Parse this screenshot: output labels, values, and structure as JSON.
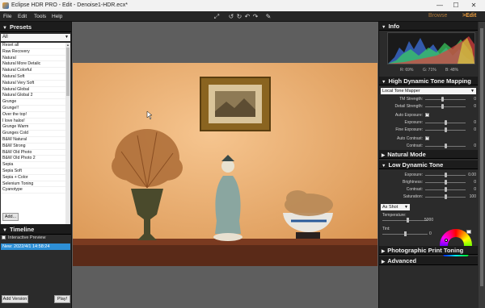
{
  "window": {
    "title": "Eclipse HDR PRO - Edit - Denoise1-HDR.ecx*",
    "minimize": "—",
    "maximize": "☐",
    "close": "✕"
  },
  "menu": {
    "items": [
      "File",
      "Edit",
      "Tools",
      "Help"
    ],
    "browse": "Browse",
    "edit": ">Edit",
    "tools": [
      "fit-screen-icon",
      "rotate-left-icon",
      "rotate-right-icon",
      "undo-icon",
      "redo-icon",
      "brush-icon"
    ],
    "tool_glyphs": [
      "⤢",
      "↺",
      "↻",
      "↶",
      "↷",
      "✎"
    ]
  },
  "presets": {
    "header": "Presets",
    "filter": "All",
    "items": [
      "Reset all",
      "Raw Recovery",
      "Natural",
      "Natural More Detalic",
      "Natural Colorful",
      "Natural Soft",
      "Natural Very Soft",
      "Natural Global",
      "Natural Global 2",
      "Grunge",
      "Grunge!!",
      "Over the top!",
      "I love halos!",
      "Grunge Warm",
      "Grunges Cold",
      "B&W Natural",
      "B&W Strong",
      "B&W Old Photo",
      "B&W Old Photo 2",
      "Sepia",
      "Sepia Soft",
      "Sepia + Color",
      "Selenium Toning",
      "Cyanotype"
    ],
    "add_button": "Add..."
  },
  "timeline": {
    "header": "Timeline",
    "interactive_preview": "Interactive Preview",
    "entry": "New: 2022/4/1 14:58:24",
    "add_version": "Add Version",
    "play": "Play!"
  },
  "info": {
    "header": "Info",
    "r": "R: 69%",
    "g": "G: 71%",
    "b": "B: 48%"
  },
  "hdtm": {
    "header": "High Dynamic Tone Mapping",
    "mapper": "Local Tone Mapper",
    "sliders": [
      {
        "label": "TM Strength:",
        "value": "0",
        "pos": 0.42
      },
      {
        "label": "Detail Strength:",
        "value": "0",
        "pos": 0.42
      },
      {
        "label": "Exposure:",
        "value": "0",
        "pos": 0.5
      },
      {
        "label": "Fine Exposure:",
        "value": "0",
        "pos": 0.5
      },
      {
        "label": "Contrast:",
        "value": "0",
        "pos": 0.5
      }
    ],
    "auto_exposure": "Auto Exposure:",
    "auto_contrast": "Auto Contrast:"
  },
  "natural_mode": {
    "header": "Natural Mode"
  },
  "low_dynamic": {
    "header": "Low Dynamic Tone",
    "sliders": [
      {
        "label": "Exposure:",
        "value": "0.00",
        "pos": 0.5
      },
      {
        "label": "Brightness:",
        "value": "0",
        "pos": 0.5
      },
      {
        "label": "Contrast:",
        "value": "0",
        "pos": 0.5
      },
      {
        "label": "Saturation:",
        "value": "100",
        "pos": 0.5
      }
    ],
    "white_balance": "As Shot",
    "temperature_label": "Temperature:",
    "temperature_value": "5000",
    "temperature_pos": 0.55,
    "tint_label": "Tint:",
    "tint_value": "0",
    "tint_pos": 0.5
  },
  "photo_print": {
    "header": "Photographic Print Toning"
  },
  "advanced": {
    "header": "Advanced"
  },
  "colors": {
    "accent_orange": "#f0a040",
    "selection_blue": "#2d8fd6"
  }
}
